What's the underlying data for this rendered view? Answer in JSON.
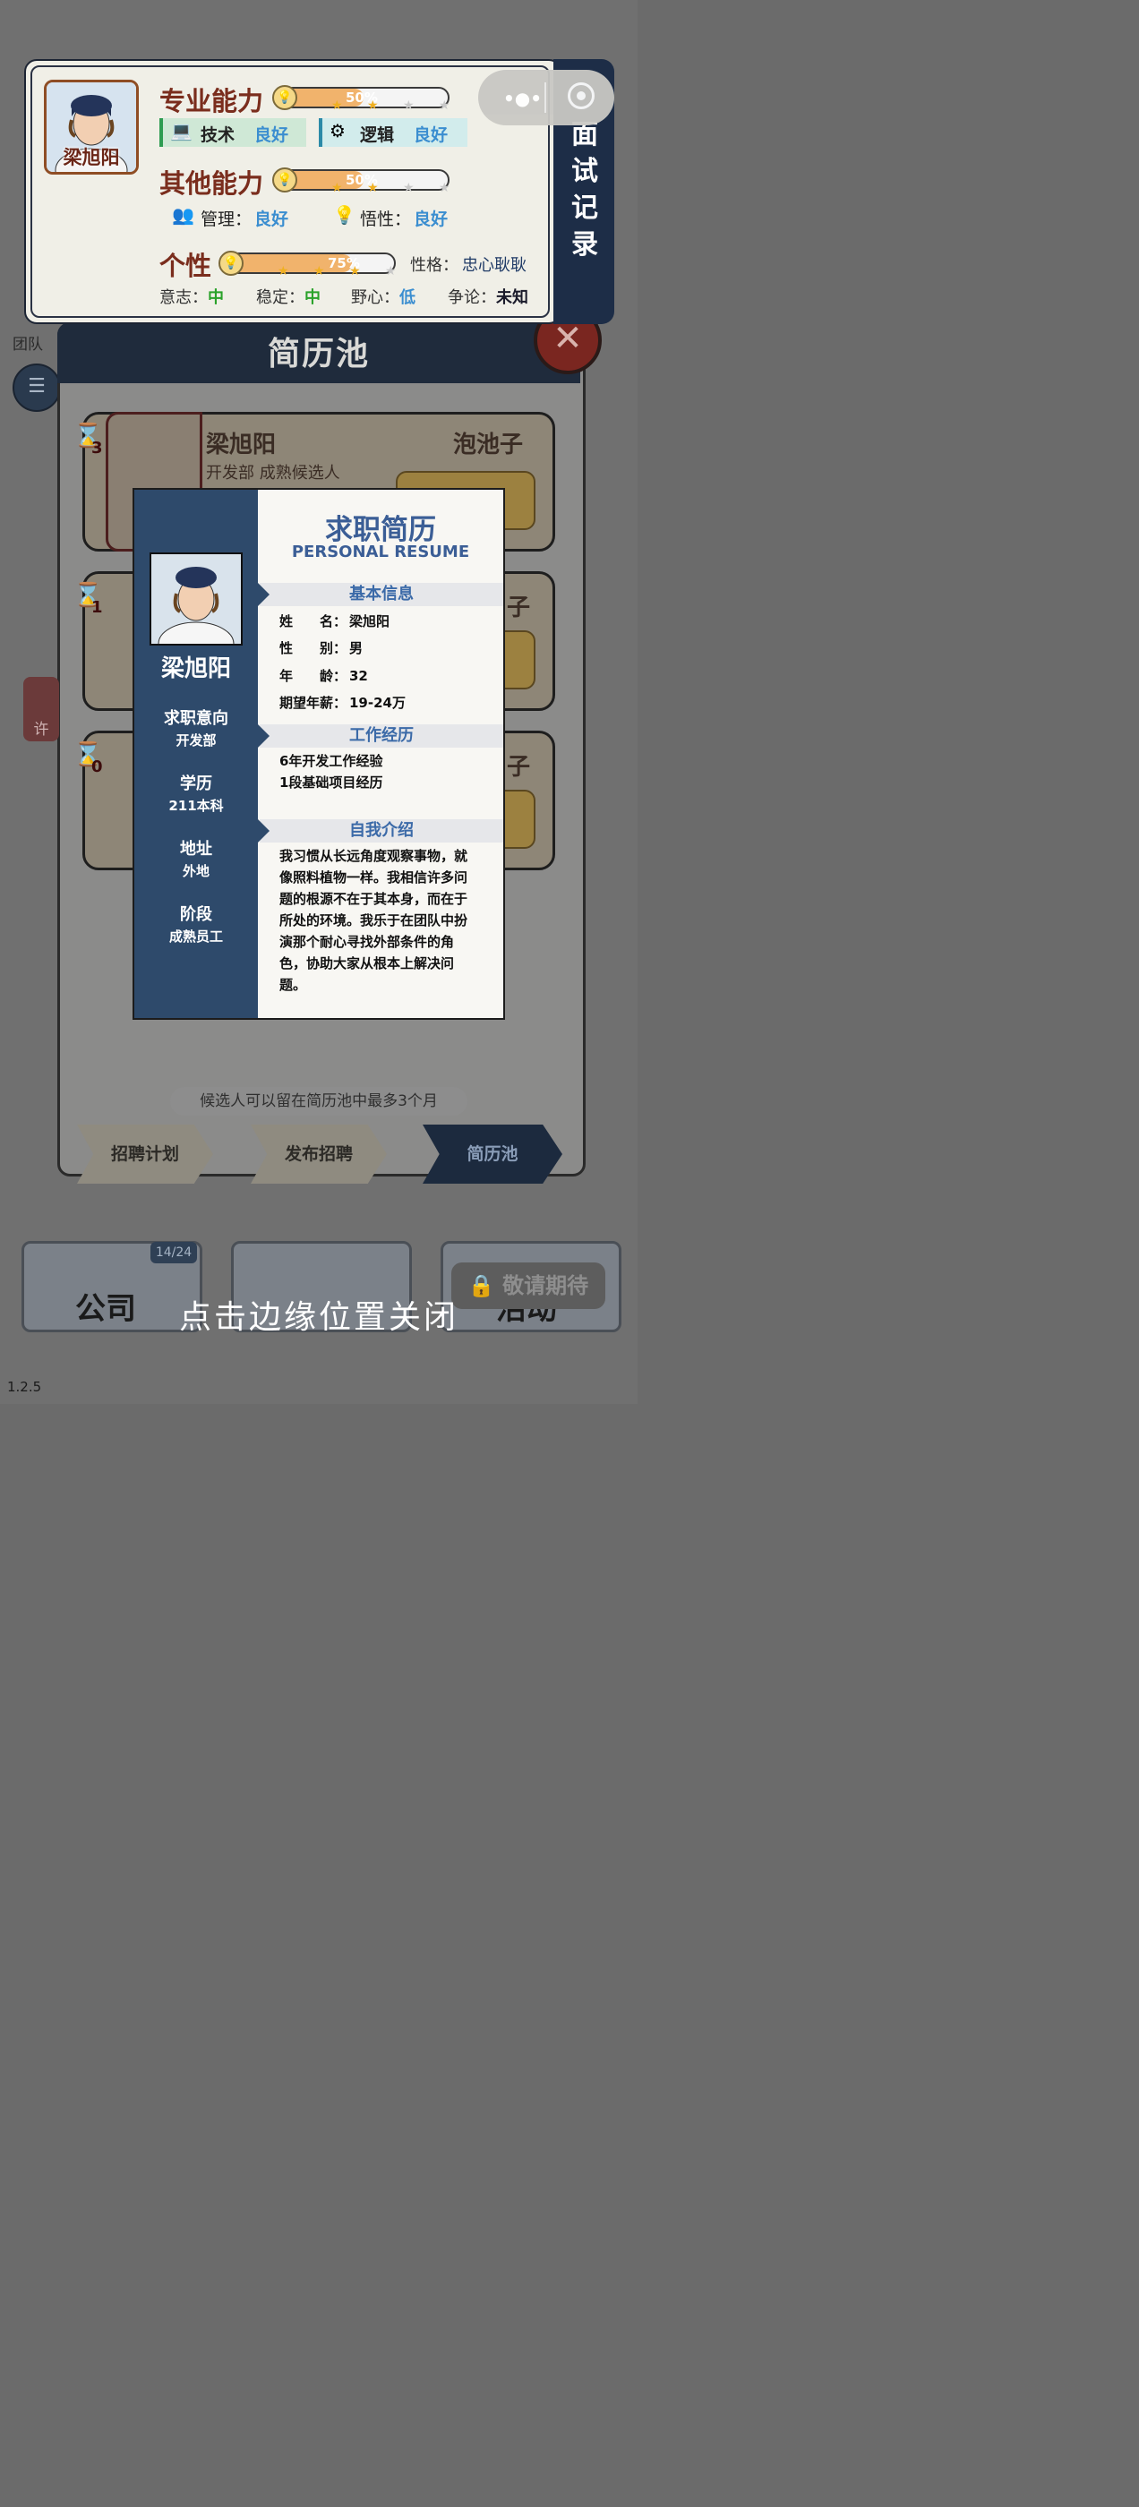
{
  "ability_panel": {
    "portrait_name": "梁旭阳",
    "professional": {
      "title": "专业能力",
      "progress": "50%",
      "progress_value": 0.5,
      "skills": [
        {
          "name": "技术",
          "value": "良好"
        },
        {
          "name": "逻辑",
          "value": "良好"
        }
      ]
    },
    "other": {
      "title": "其他能力",
      "progress": "50%",
      "progress_value": 0.5,
      "skills": [
        {
          "name": "管理：",
          "value": "良好"
        },
        {
          "name": "悟性：",
          "value": "良好"
        }
      ]
    },
    "personality": {
      "title": "个性",
      "progress": "75%",
      "progress_value": 0.75,
      "character_label": "性格：",
      "character_value": "忠心耿耿",
      "traits": [
        {
          "name": "意志：",
          "value": "中"
        },
        {
          "name": "稳定：",
          "value": "中"
        },
        {
          "name": "野心：",
          "value": "低"
        },
        {
          "name": "争论：",
          "value": "未知"
        }
      ]
    },
    "side_tab": "面试记录"
  },
  "background": {
    "pool_title": "简历池",
    "card1_name": "梁旭阳",
    "card1_sub": "开发部 成熟候选人",
    "card1_tag": "泡池子",
    "card1_hourglass": "3",
    "card2_hourglass": "1",
    "card3_hourglass": "0",
    "side_tag": "子",
    "team_label": "团队",
    "xu_label": "许",
    "note": "候选人可以留在简历池中最多3个月",
    "tabs": [
      {
        "label": "招聘计划"
      },
      {
        "label": "发布招聘"
      },
      {
        "label": "简历池"
      }
    ],
    "company_label": "公司",
    "company_count": "14/24",
    "activity_label": "活动",
    "coming_soon": "敬请期待",
    "close_hint": "点击边缘位置关闭",
    "version": "1.2.5"
  },
  "resume": {
    "title": "求职简历",
    "subtitle": "PERSONAL RESUME",
    "name": "梁旭阳",
    "side": [
      {
        "label": "求职意向",
        "value": "开发部"
      },
      {
        "label": "学历",
        "value": "211本科"
      },
      {
        "label": "地址",
        "value": "外地"
      },
      {
        "label": "阶段",
        "value": "成熟员工"
      }
    ],
    "basic_title": "基本信息",
    "basic": [
      {
        "key": "姓　　名：",
        "value": "梁旭阳"
      },
      {
        "key": "性　　别：",
        "value": "男"
      },
      {
        "key": "年　　龄：",
        "value": "32"
      },
      {
        "key": "期望年薪：",
        "value": "19-24万"
      }
    ],
    "work_title": "工作经历",
    "work": [
      "6年开发工作经验",
      "1段基础项目经历"
    ],
    "intro_title": "自我介绍",
    "intro": [
      "我习惯从长远角度观察事物，就",
      "像照料植物一样。我相信许多问",
      "题的根源不在于其本身，而在于",
      "所处的环境。我乐于在团队中扮",
      "演那个耐心寻找外部条件的角",
      "色，协助大家从根本上解决问",
      "题。"
    ]
  },
  "colors": {
    "panel_bg": "#f0efe7",
    "section_title": "#7a2d1d",
    "resume_sidebar": "#2e4a6b",
    "resume_accent": "#3b5e96",
    "good_value": "#3b8ed0",
    "mid_value": "#2aa22a"
  }
}
